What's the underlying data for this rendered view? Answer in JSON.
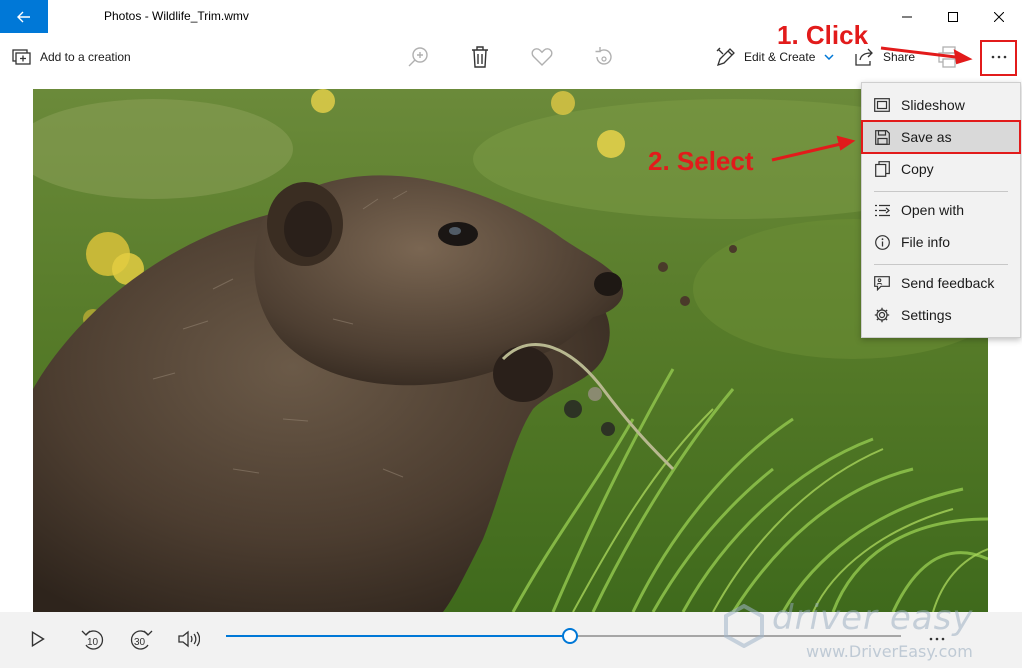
{
  "window": {
    "title": "Photos - Wildlife_Trim.wmv"
  },
  "toolbar": {
    "add_to_creation": "Add to a creation",
    "edit_create": "Edit & Create",
    "share": "Share"
  },
  "menu": {
    "items": [
      {
        "label": "Slideshow",
        "icon": "slideshow-icon"
      },
      {
        "label": "Save as",
        "icon": "save-icon",
        "selected": true
      },
      {
        "label": "Copy",
        "icon": "copy-icon"
      },
      {
        "label": "Open with",
        "icon": "open-with-icon"
      },
      {
        "label": "File info",
        "icon": "info-icon"
      },
      {
        "label": "Send feedback",
        "icon": "feedback-icon"
      },
      {
        "label": "Settings",
        "icon": "gear-icon"
      }
    ]
  },
  "controls": {
    "rewind_seconds": "10",
    "forward_seconds": "30",
    "progress": 0.51
  },
  "annotations": {
    "step1": "1. Click",
    "step2": "2. Select"
  },
  "watermark": {
    "brand": "driver easy",
    "url": "www.DriverEasy.com"
  },
  "colors": {
    "accent": "#0078d7",
    "annotation": "#e21b1b"
  }
}
